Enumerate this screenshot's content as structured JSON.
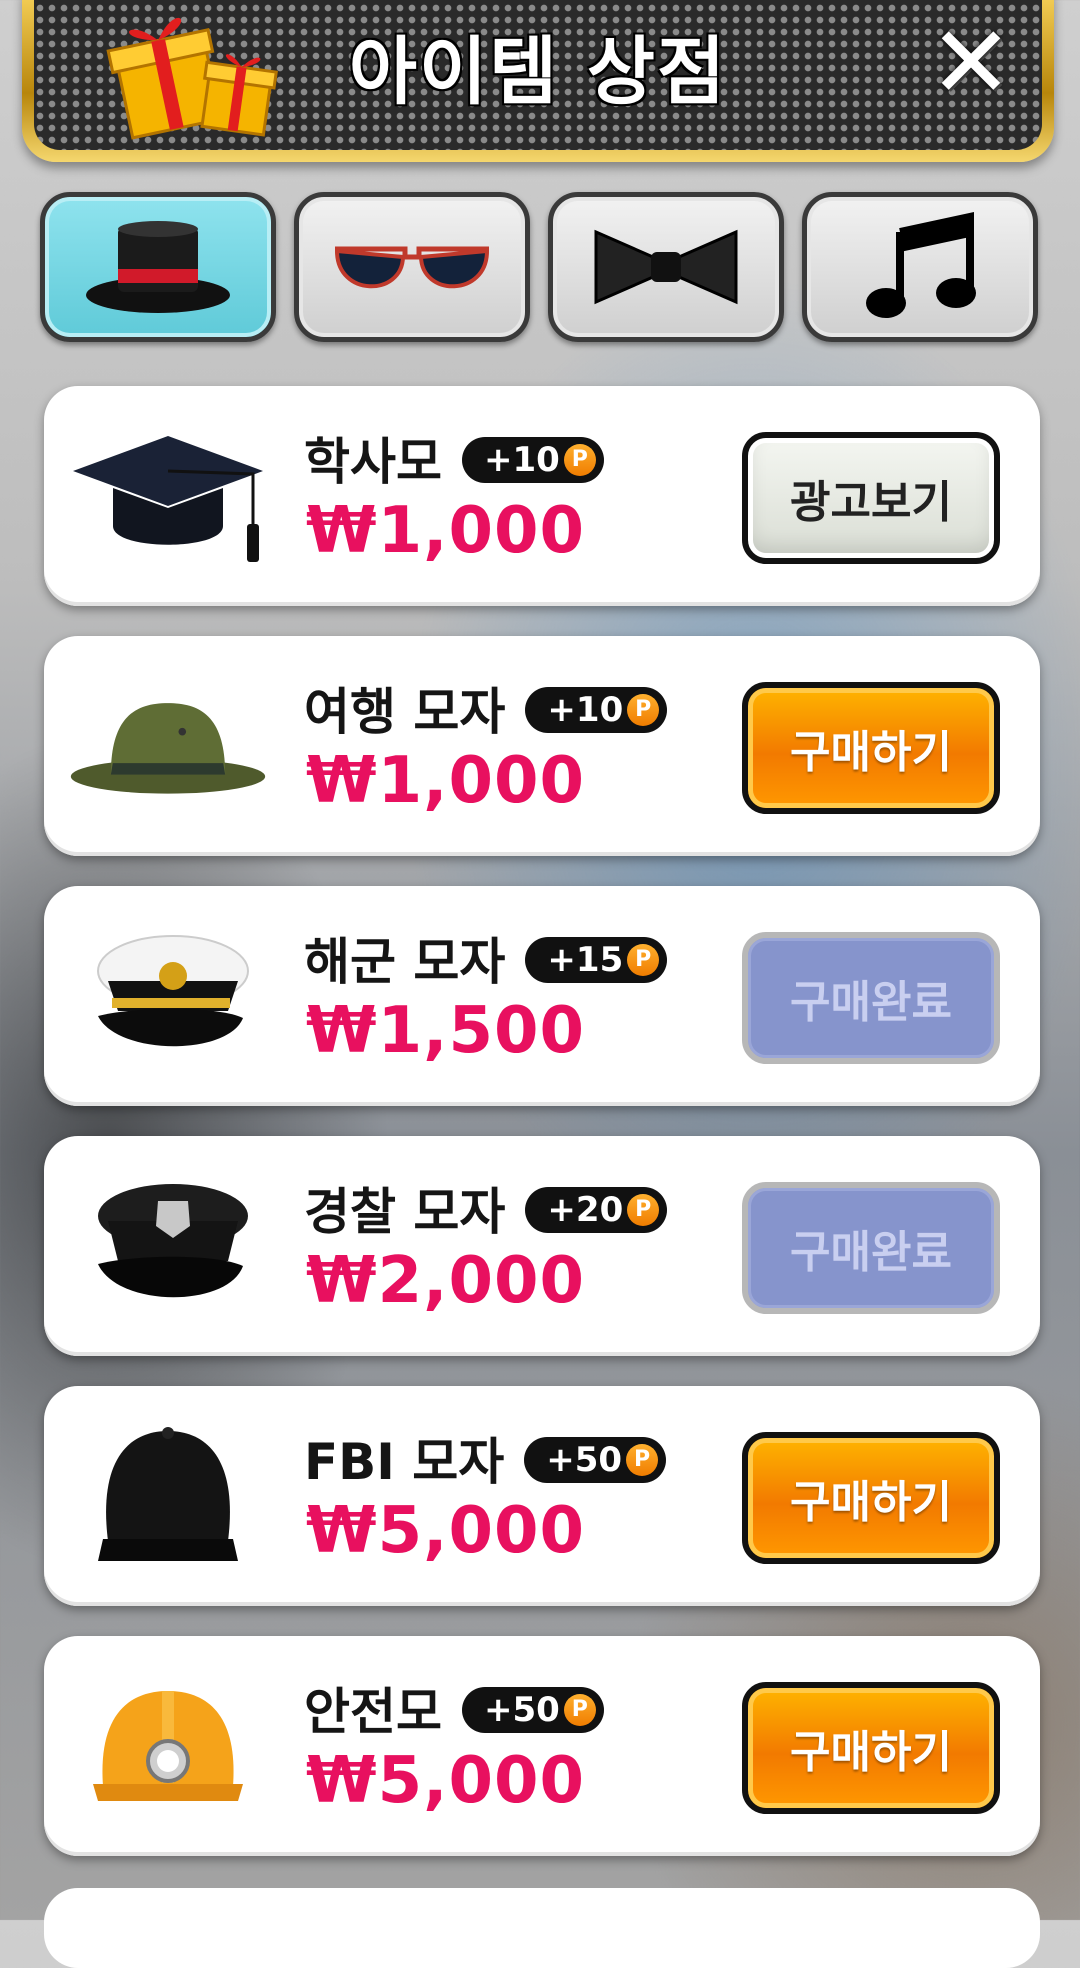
{
  "header": {
    "title": "아이템 상점",
    "close_icon": "close-icon"
  },
  "tabs": [
    {
      "name": "hat",
      "icon": "top-hat-icon",
      "active": true
    },
    {
      "name": "glasses",
      "icon": "sunglasses-icon",
      "active": false
    },
    {
      "name": "bowtie",
      "icon": "bowtie-icon",
      "active": false
    },
    {
      "name": "music",
      "icon": "music-note-icon",
      "active": false
    }
  ],
  "items": [
    {
      "name": "학사모",
      "points": "+10",
      "point_symbol": "P",
      "price": "₩1,000",
      "action": "광고보기",
      "action_state": "ad",
      "icon": "graduation-cap-icon"
    },
    {
      "name": "여행 모자",
      "points": "+10",
      "point_symbol": "P",
      "price": "₩1,000",
      "action": "구매하기",
      "action_state": "buy",
      "icon": "ranger-hat-icon"
    },
    {
      "name": "해군 모자",
      "points": "+15",
      "point_symbol": "P",
      "price": "₩1,500",
      "action": "구매완료",
      "action_state": "done",
      "icon": "navy-cap-icon"
    },
    {
      "name": "경찰 모자",
      "points": "+20",
      "point_symbol": "P",
      "price": "₩2,000",
      "action": "구매완료",
      "action_state": "done",
      "icon": "police-cap-icon"
    },
    {
      "name": "FBI 모자",
      "points": "+50",
      "point_symbol": "P",
      "price": "₩5,000",
      "action": "구매하기",
      "action_state": "buy",
      "icon": "fbi-cap-icon"
    },
    {
      "name": "안전모",
      "points": "+50",
      "point_symbol": "P",
      "price": "₩5,000",
      "action": "구매하기",
      "action_state": "buy",
      "icon": "safety-helmet-icon"
    }
  ],
  "colors": {
    "price": "#e8105f",
    "buy": "#f27a00",
    "done": "#8694cc",
    "active_tab": "#5fcad8"
  }
}
